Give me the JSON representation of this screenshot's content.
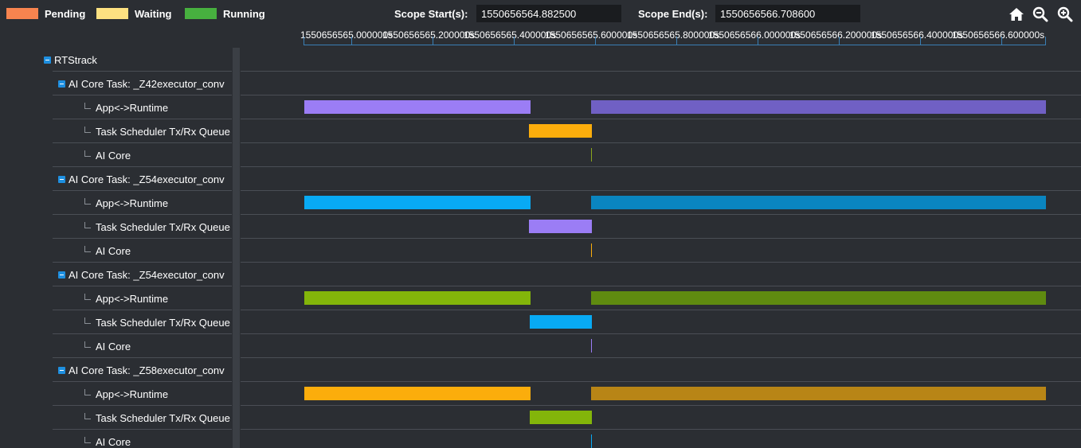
{
  "legend": [
    {
      "label": "Pending",
      "color": "#f7844f"
    },
    {
      "label": "Waiting",
      "color": "#fde181"
    },
    {
      "label": "Running",
      "color": "#47b03f"
    }
  ],
  "scope": {
    "start_label": "Scope Start(s):",
    "start_value": "1550656564.882500",
    "end_label": "Scope End(s):",
    "end_value": "1550656566.708600"
  },
  "toolbar": {
    "home_icon": "home-icon",
    "zoom_out_icon": "zoom-out-icon",
    "zoom_in_icon": "zoom-in-icon"
  },
  "axis": {
    "ticks": [
      "1550656565.000000s",
      "1550656565.200000s",
      "1550656565.400000s",
      "1550656565.600000s",
      "1550656565.800000s",
      "1550656566.000000s",
      "1550656566.200000s",
      "1550656566.400000s",
      "1550656566.600000s"
    ]
  },
  "tree": {
    "root": "RTStrack",
    "tasks": [
      {
        "label": "AI Core Task: _Z42executor_conv",
        "children": [
          "App<->Runtime",
          "Task Scheduler Tx/Rx Queue",
          "AI Core"
        ],
        "colors": {
          "app_a": "#9b7df5",
          "app_b": "#7060c4",
          "sched": "#fbad0c",
          "core": "#8aa61e"
        }
      },
      {
        "label": "AI Core Task: _Z54executor_conv",
        "children": [
          "App<->Runtime",
          "Task Scheduler Tx/Rx Queue",
          "AI Core"
        ],
        "colors": {
          "app_a": "#08aaf4",
          "app_b": "#0a85c0",
          "sched": "#9b7df5",
          "core": "#fbad0c"
        }
      },
      {
        "label": "AI Core Task: _Z54executor_conv",
        "children": [
          "App<->Runtime",
          "Task Scheduler Tx/Rx Queue",
          "AI Core"
        ],
        "colors": {
          "app_a": "#83b50a",
          "app_b": "#5f8b10",
          "sched": "#08aaf4",
          "core": "#9b7df5"
        }
      },
      {
        "label": "AI Core Task: _Z58executor_conv",
        "children": [
          "App<->Runtime",
          "Task Scheduler Tx/Rx Queue",
          "AI Core"
        ],
        "colors": {
          "app_a": "#fbad0c",
          "app_b": "#b88516",
          "sched": "#83b50a",
          "core": "#08aaf4"
        }
      }
    ]
  }
}
